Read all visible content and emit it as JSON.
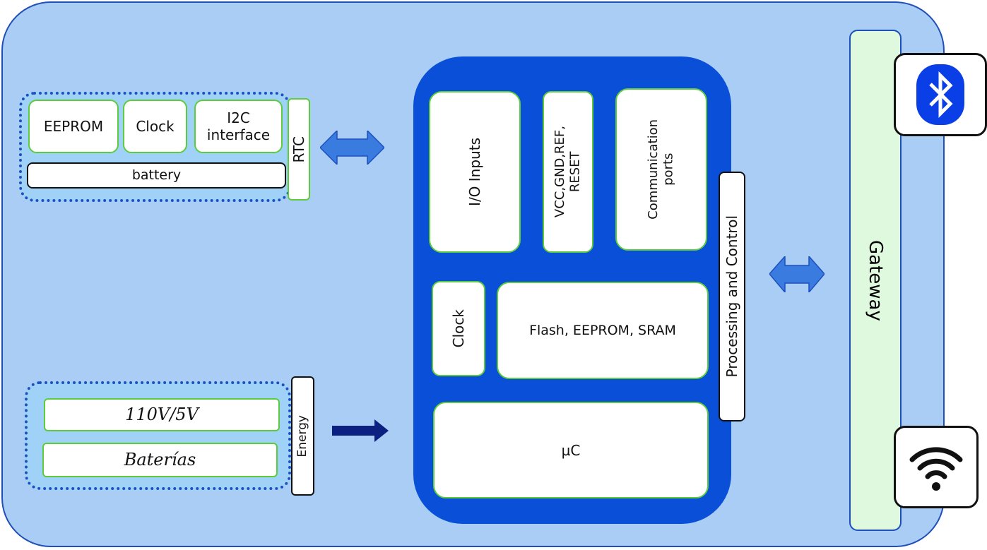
{
  "rtc_module": {
    "label": "RTC",
    "eeprom": "EEPROM",
    "clock": "Clock",
    "i2c_line1": "I2C",
    "i2c_line2": "interface",
    "battery": "battery"
  },
  "energy_module": {
    "label": "Energy",
    "converter": "110V/5V",
    "batteries": "Baterías"
  },
  "microcontroller": {
    "io_inputs": "I/O Inputs",
    "power_pins_line1": "VCC,GND,REF,",
    "power_pins_line2": "RESET",
    "comm_line1": "Communication",
    "comm_line2": "ports",
    "clock": "Clock",
    "memory": "Flash, EEPROM, SRAM",
    "uc": "µC",
    "processing": "Processing and Control"
  },
  "gateway": {
    "label": "Gateway",
    "icons": [
      "bluetooth-icon",
      "wifi-icon"
    ]
  },
  "colors": {
    "background": "#a9cdf4",
    "core": "#0a4fd8",
    "gateway": "#def9dd",
    "box_border": "#5ccc3c",
    "arrow": "#3a7be0",
    "energy_arrow": "#0b2080"
  }
}
